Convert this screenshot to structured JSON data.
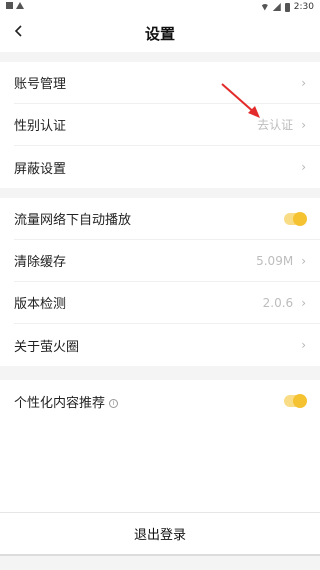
{
  "status_bar": {
    "time": "2:30"
  },
  "header": {
    "title": "设置"
  },
  "group1": {
    "items": [
      {
        "label": "账号管理"
      },
      {
        "label": "性别认证",
        "value": "去认证"
      },
      {
        "label": "屏蔽设置"
      }
    ]
  },
  "group2": {
    "items": [
      {
        "label": "流量网络下自动播放",
        "toggle": true
      },
      {
        "label": "清除缓存",
        "value": "5.09M"
      },
      {
        "label": "版本检测",
        "value": "2.0.6"
      },
      {
        "label": "关于萤火圈"
      }
    ]
  },
  "group3": {
    "items": [
      {
        "label": "个性化内容推荐",
        "toggle": true,
        "info_icon": "info-icon"
      }
    ]
  },
  "footer": {
    "logout_label": "退出登录"
  },
  "colors": {
    "accent": "#f5c231",
    "annotation": "#e32b2b"
  }
}
